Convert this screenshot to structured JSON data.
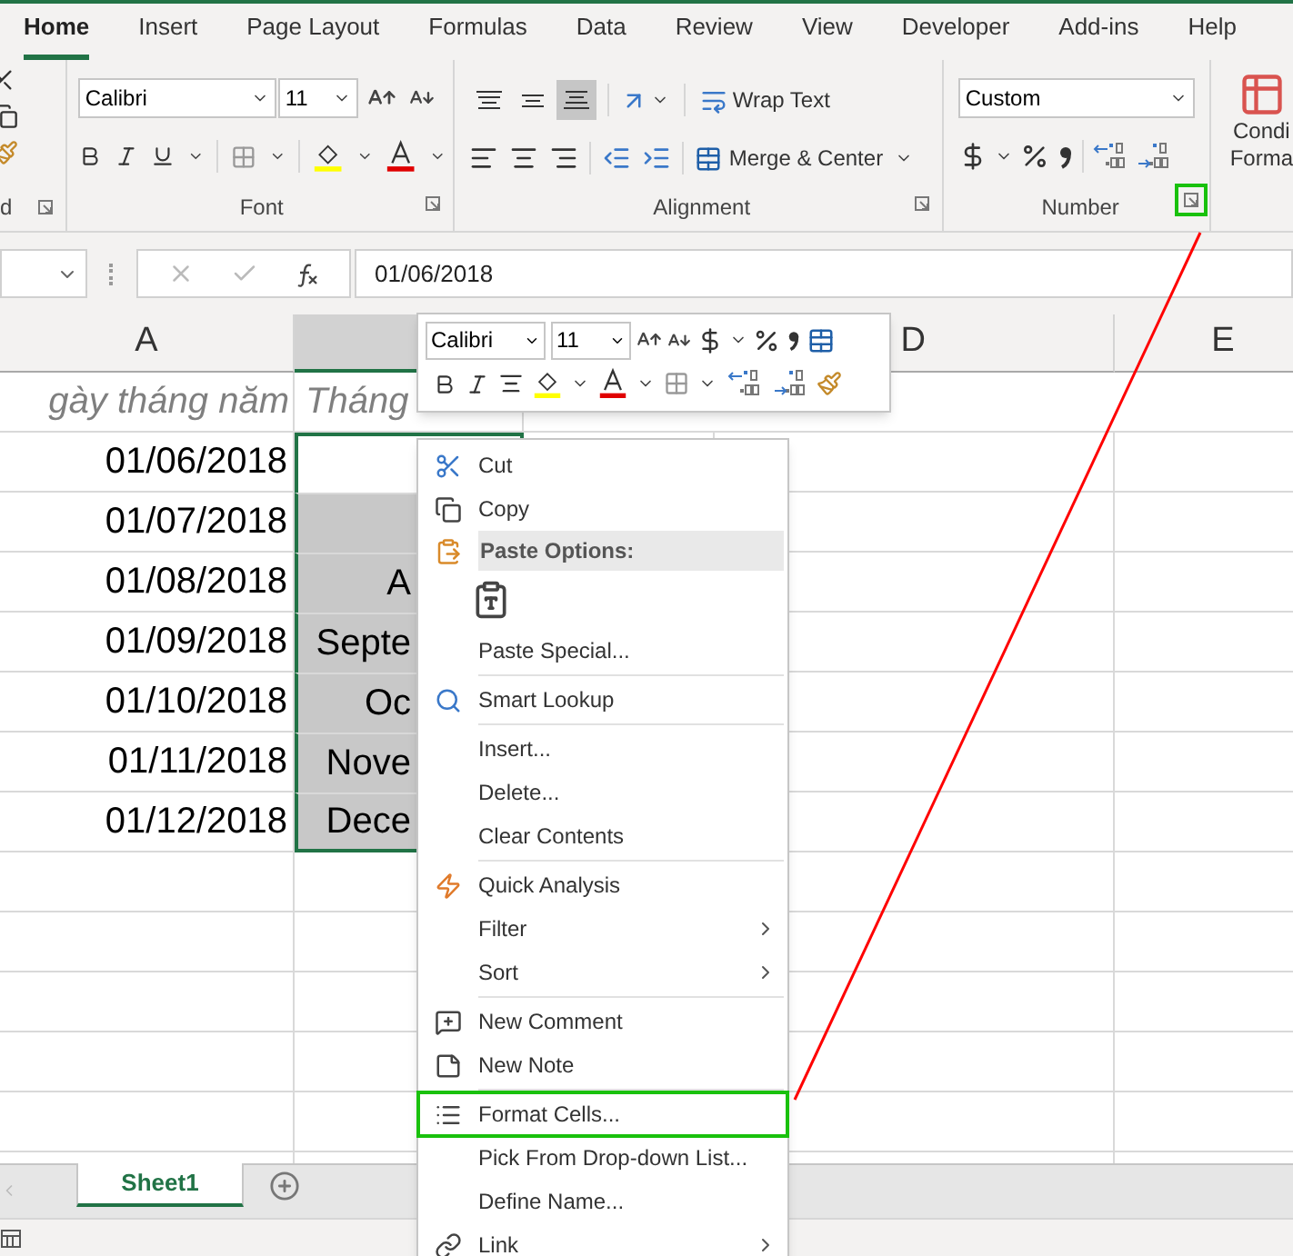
{
  "ribbon": {
    "tabs": [
      {
        "label": "Home",
        "selected": true
      },
      {
        "label": "Insert",
        "selected": false
      },
      {
        "label": "Page Layout",
        "selected": false
      },
      {
        "label": "Formulas",
        "selected": false
      },
      {
        "label": "Data",
        "selected": false
      },
      {
        "label": "Review",
        "selected": false
      },
      {
        "label": "View",
        "selected": false
      },
      {
        "label": "Developer",
        "selected": false
      },
      {
        "label": "Add-ins",
        "selected": false
      },
      {
        "label": "Help",
        "selected": false
      }
    ],
    "clipboard": {
      "label": "d"
    },
    "font": {
      "font_name": "Calibri",
      "font_size": "11",
      "label": "Font"
    },
    "alignment": {
      "vertical": [
        {
          "selected": false
        },
        {
          "selected": false
        },
        {
          "selected": true
        }
      ],
      "wrap_text": "Wrap Text",
      "merge": "Merge & Center",
      "label": "Alignment"
    },
    "number": {
      "format": "Custom",
      "label": "Number",
      "launcher_highlighted": true
    },
    "conditional": {
      "lines": [
        "Condi",
        "Forma"
      ]
    }
  },
  "formula_bar": {
    "value": "01/06/2018"
  },
  "sheet": {
    "columns": [
      {
        "label": "A",
        "selected": false
      },
      {
        "selected": true
      },
      {
        "label": "D",
        "selected": false
      },
      {
        "label": "E",
        "selected": false
      }
    ],
    "heading_row": {
      "date": "gày tháng năm",
      "month": "Tháng"
    },
    "rows": [
      {
        "date": "01/06/2018",
        "filled": false,
        "selected": true
      },
      {
        "date": "01/07/2018",
        "filled": true,
        "selected": true
      },
      {
        "date": "01/08/2018",
        "month": "A",
        "filled": true,
        "selected": true
      },
      {
        "date": "01/09/2018",
        "month": "Septe",
        "filled": true,
        "selected": true
      },
      {
        "date": "01/10/2018",
        "month": "Oc",
        "filled": true,
        "selected": true
      },
      {
        "date": "01/11/2018",
        "month": "Nove",
        "filled": true,
        "selected": true
      },
      {
        "date": "01/12/2018",
        "month": "Dece",
        "filled": true,
        "selected": true
      }
    ]
  },
  "mini_toolbar": {
    "font_name": "Calibri",
    "font_size": "11"
  },
  "context_menu": [
    {
      "kind": "item",
      "label": "Cut",
      "submenu": false,
      "highlighted": false
    },
    {
      "kind": "item",
      "label": "Copy",
      "submenu": false,
      "highlighted": false
    },
    {
      "kind": "header",
      "label": "Paste Options:"
    },
    {
      "kind": "paste_buttons"
    },
    {
      "kind": "item",
      "label": "Paste Special...",
      "submenu": false,
      "highlighted": false
    },
    {
      "kind": "separator"
    },
    {
      "kind": "item",
      "label": "Smart Lookup",
      "submenu": false,
      "highlighted": false
    },
    {
      "kind": "separator"
    },
    {
      "kind": "item",
      "label": "Insert...",
      "submenu": false,
      "highlighted": false
    },
    {
      "kind": "item",
      "label": "Delete...",
      "submenu": false,
      "highlighted": false
    },
    {
      "kind": "item",
      "label": "Clear Contents",
      "submenu": false,
      "highlighted": false
    },
    {
      "kind": "separator"
    },
    {
      "kind": "item",
      "label": "Quick Analysis",
      "submenu": false,
      "highlighted": false
    },
    {
      "kind": "item",
      "label": "Filter",
      "submenu": true,
      "highlighted": false
    },
    {
      "kind": "item",
      "label": "Sort",
      "submenu": true,
      "highlighted": false
    },
    {
      "kind": "separator"
    },
    {
      "kind": "item",
      "label": "New Comment",
      "submenu": false,
      "highlighted": false
    },
    {
      "kind": "item",
      "label": "New Note",
      "submenu": false,
      "highlighted": false
    },
    {
      "kind": "separator"
    },
    {
      "kind": "item",
      "label": "Format Cells...",
      "submenu": false,
      "highlighted": true
    },
    {
      "kind": "item",
      "label": "Pick From Drop-down List...",
      "submenu": false,
      "highlighted": false
    },
    {
      "kind": "item",
      "label": "Define Name...",
      "submenu": false,
      "highlighted": false
    },
    {
      "kind": "item",
      "label": "Link",
      "submenu": true,
      "highlighted": false
    }
  ],
  "sheet_tabs": [
    {
      "label": "Sheet1",
      "selected": true
    }
  ]
}
